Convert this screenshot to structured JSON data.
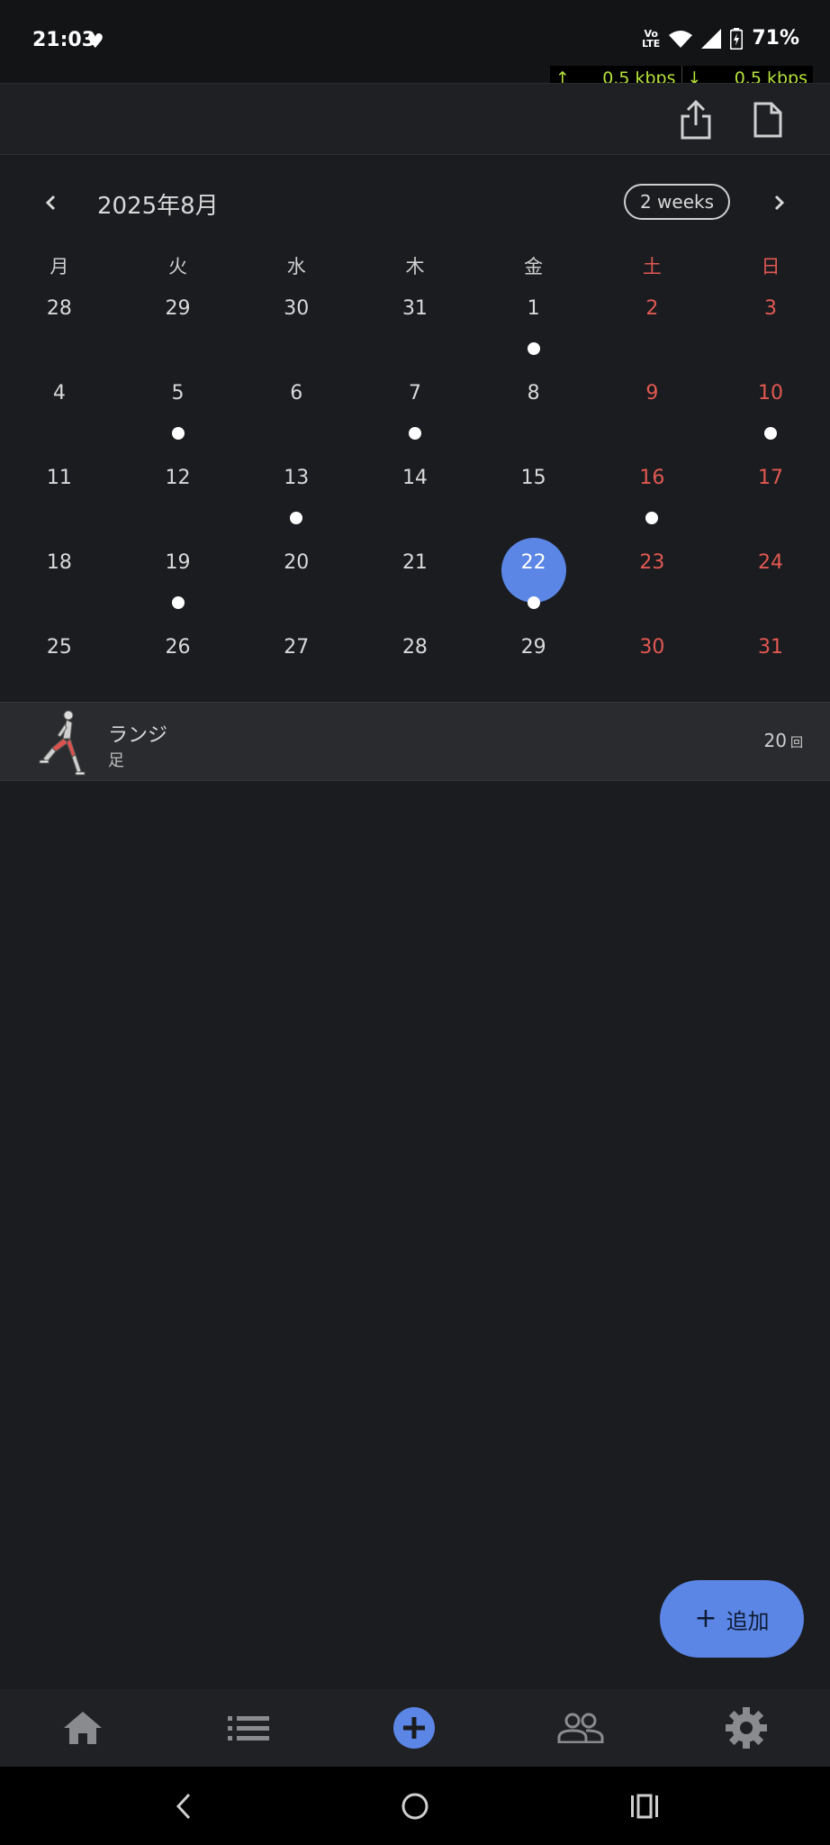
{
  "status": {
    "time": "21:03",
    "battery": "71%",
    "network": "VoLTE",
    "upload_speed": "0.5 kbps",
    "download_speed": "0.5 kbps"
  },
  "toolbar": {
    "icons": [
      "share-icon",
      "document-icon"
    ]
  },
  "calendar": {
    "month_label": "2025年8月",
    "format_button": "2 weeks",
    "weekdays": [
      "月",
      "火",
      "水",
      "木",
      "金",
      "土",
      "日"
    ],
    "weeks": [
      [
        "28",
        "29",
        "30",
        "31",
        "1",
        "2",
        "3"
      ],
      [
        "4",
        "5",
        "6",
        "7",
        "8",
        "9",
        "10"
      ],
      [
        "11",
        "12",
        "13",
        "14",
        "15",
        "16",
        "17"
      ],
      [
        "18",
        "19",
        "20",
        "21",
        "22",
        "23",
        "24"
      ],
      [
        "25",
        "26",
        "27",
        "28",
        "29",
        "30",
        "31"
      ]
    ],
    "selected": "22",
    "event_days": [
      "1",
      "5",
      "7",
      "10",
      "13",
      "16",
      "19",
      "22"
    ],
    "colors": {
      "weekend": "#e25852",
      "selected": "#5b86e5"
    }
  },
  "workout": {
    "name": "ランジ",
    "category": "足",
    "count": "20",
    "unit": "回"
  },
  "fab": {
    "label": "追加",
    "icon": "plus-icon"
  },
  "bottom_nav": [
    "home-icon",
    "list-icon",
    "add-circle-icon",
    "people-icon",
    "settings-icon"
  ],
  "system_nav": [
    "back-icon",
    "home-circle-icon",
    "recents-icon"
  ]
}
